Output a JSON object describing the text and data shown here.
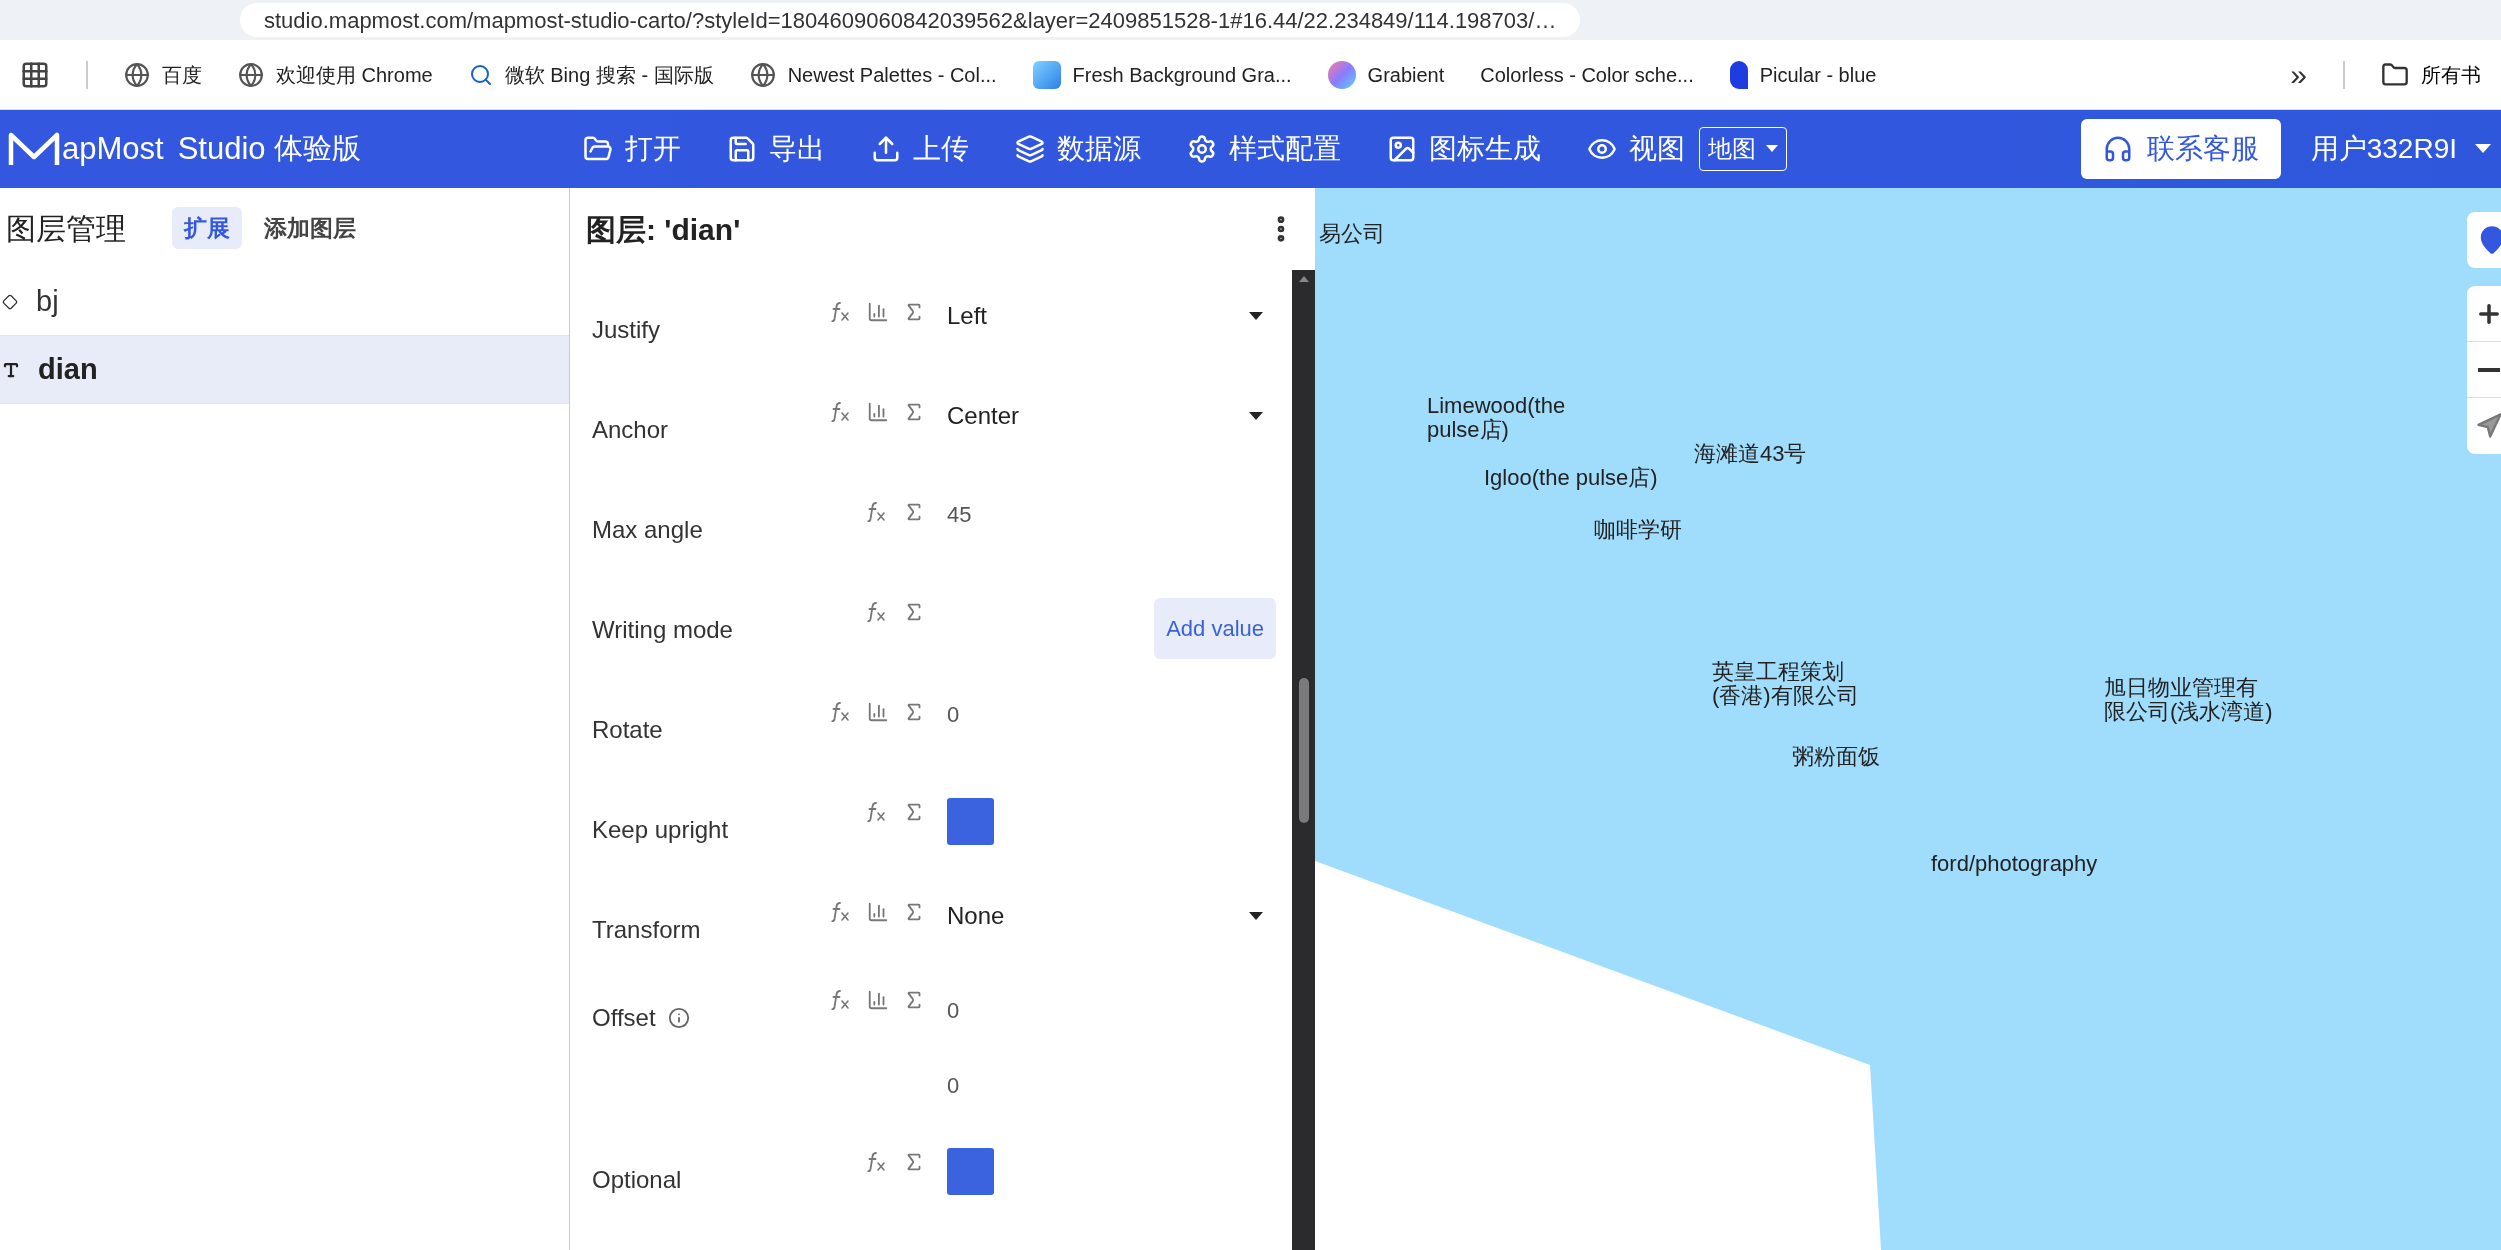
{
  "browser": {
    "url": "studio.mapmost.com/mapmost-studio-carto/?styleId=1804609060842039562&layer=2409851528-1#16.44/22.234849/114.198703/…",
    "bookmarks": [
      {
        "label": "百度",
        "kind": "globe"
      },
      {
        "label": "欢迎使用 Chrome",
        "kind": "globe"
      },
      {
        "label": "微软 Bing 搜索 - 国际版",
        "kind": "search"
      },
      {
        "label": "Newest Palettes - Col...",
        "kind": "globe"
      },
      {
        "label": "Fresh Background Gra...",
        "kind": "swatch"
      },
      {
        "label": "Grabient",
        "kind": "gradient"
      },
      {
        "label": "Colorless - Color sche...",
        "kind": "none"
      },
      {
        "label": "Picular - blue",
        "kind": "drop"
      }
    ],
    "overflow": "»",
    "folder": "所有书"
  },
  "header": {
    "brand": "apMost",
    "product": "Studio",
    "edition": "体验版",
    "nav": [
      {
        "label": "打开"
      },
      {
        "label": "导出"
      },
      {
        "label": "上传"
      },
      {
        "label": "数据源"
      },
      {
        "label": "样式配置"
      },
      {
        "label": "图标生成"
      },
      {
        "label": "视图"
      }
    ],
    "view_select": "地图",
    "support": "联系客服",
    "user": "用户332R9I"
  },
  "layers_panel": {
    "title": "图层管理",
    "tabs": [
      {
        "label": "扩展",
        "selected": true
      },
      {
        "label": "添加图层",
        "selected": false
      }
    ],
    "layers": [
      {
        "name": "bj",
        "kind": "fill",
        "selected": false
      },
      {
        "name": "dian",
        "kind": "text",
        "selected": true
      }
    ]
  },
  "properties_panel": {
    "title": "图层: 'dian'",
    "properties": [
      {
        "label": "Justify",
        "kind": "select",
        "data_driven": true,
        "value": "Left"
      },
      {
        "label": "Anchor",
        "kind": "select",
        "data_driven": true,
        "value": "Center"
      },
      {
        "label": "Max angle",
        "kind": "number",
        "data_driven": false,
        "value": "45"
      },
      {
        "label": "Writing mode",
        "kind": "add",
        "data_driven": false,
        "value": "Add value"
      },
      {
        "label": "Rotate",
        "kind": "number",
        "data_driven": true,
        "value": "0"
      },
      {
        "label": "Keep upright",
        "kind": "toggle",
        "data_driven": false,
        "checked": true
      },
      {
        "label": "Transform",
        "kind": "select",
        "data_driven": true,
        "value": "None"
      },
      {
        "label": "Offset",
        "kind": "pair",
        "data_driven": true,
        "info": true,
        "values": [
          "0",
          "0"
        ]
      },
      {
        "label": "Optional",
        "kind": "toggle",
        "data_driven": false,
        "checked": true
      }
    ]
  },
  "map": {
    "labels": [
      {
        "lines": [
          "易公司"
        ]
      },
      {
        "lines": [
          "Limewood(the",
          "pulse店)"
        ]
      },
      {
        "lines": [
          "海滩道43号"
        ]
      },
      {
        "lines": [
          "Igloo(the pulse店)"
        ]
      },
      {
        "lines": [
          "咖啡学研"
        ]
      },
      {
        "lines": [
          "英皇工程策划",
          "(香港)有限公司"
        ]
      },
      {
        "lines": [
          "旭日物业管理有",
          "限公司(浅水湾道)"
        ]
      },
      {
        "lines": [
          "粥粉面饭"
        ]
      },
      {
        "lines": [
          "ford/photography"
        ]
      }
    ]
  }
}
